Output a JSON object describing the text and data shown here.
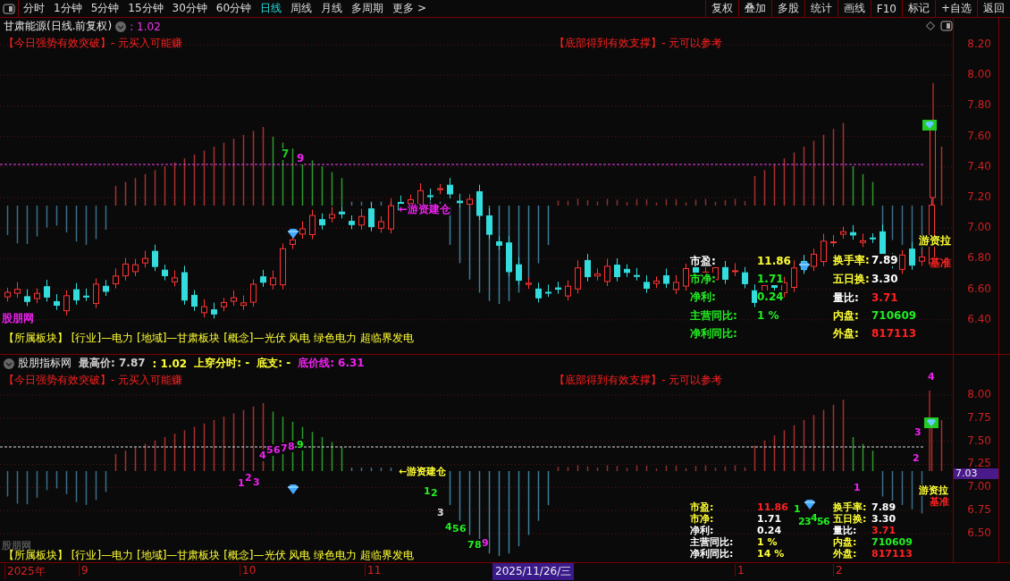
{
  "toolbar": {
    "periods": [
      {
        "label": "分时",
        "selected": false
      },
      {
        "label": "1分钟",
        "selected": false
      },
      {
        "label": "5分钟",
        "selected": false
      },
      {
        "label": "15分钟",
        "selected": false
      },
      {
        "label": "30分钟",
        "selected": false
      },
      {
        "label": "60分钟",
        "selected": false
      },
      {
        "label": "日线",
        "selected": true
      },
      {
        "label": "周线",
        "selected": false
      },
      {
        "label": "月线",
        "selected": false
      },
      {
        "label": "多周期",
        "selected": false
      },
      {
        "label": "更多 >",
        "selected": false
      }
    ],
    "buttons": [
      "复权",
      "叠加",
      "多股",
      "统计",
      "画线",
      "F10",
      "标记",
      "+自选",
      "返回"
    ]
  },
  "main_panel": {
    "title": "甘肃能源(日线.前复权)",
    "value": ": 1.02",
    "signals": [
      "【今日强势有效突破】- 元买入可能赚",
      "【底部得到有效支撑】- 元可以参考"
    ],
    "price_ticks": [
      "8.20",
      "8.00",
      "7.80",
      "7.60",
      "7.40",
      "7.20",
      "7.00",
      "6.80",
      "6.60",
      "6.40"
    ],
    "annotations": [
      {
        "text": "7",
        "color": "#22cc22"
      },
      {
        "text": "9",
        "color": "#ee22ee"
      },
      {
        "text": "←游资建仓",
        "color": "#ee22ee"
      },
      {
        "text": "游资拉",
        "color": "#ffff33"
      },
      {
        "text": "基准",
        "color": "#ff2222"
      },
      {
        "text": "股朋网",
        "color": "#ee22ee"
      }
    ],
    "stats": [
      {
        "label": {
          "text": "市盈:",
          "color": "#ffffff"
        },
        "value": {
          "text": "11.86",
          "color": "#ffff33"
        }
      },
      {
        "label": {
          "text": "市净:",
          "color": "#22ee22"
        },
        "value": {
          "text": "1.71",
          "color": "#22ee22"
        }
      },
      {
        "label": {
          "text": "净利:",
          "color": "#22ee22"
        },
        "value": {
          "text": "0.24",
          "color": "#22ee22"
        }
      },
      {
        "label": {
          "text": "主营同比:",
          "color": "#22ee22"
        },
        "value": {
          "text": "1 %",
          "color": "#22ee22"
        }
      },
      {
        "label": {
          "text": "净利同比:",
          "color": "#22ee22"
        }
      },
      {
        "label": {
          "text": "换手率:",
          "color": "#ffff33"
        },
        "value": {
          "text": "7.89",
          "color": "#ffffff"
        }
      },
      {
        "label": {
          "text": "五日换:",
          "color": "#ffff33"
        },
        "value": {
          "text": "3.30",
          "color": "#ffffff"
        }
      },
      {
        "label": {
          "text": "量比:",
          "color": "#ffffff"
        },
        "value": {
          "text": "3.71",
          "color": "#ff2222"
        }
      },
      {
        "label": {
          "text": "内盘:",
          "color": "#ffff33"
        },
        "value": {
          "text": "710609",
          "color": "#22ee22"
        }
      },
      {
        "label": {
          "text": "外盘:",
          "color": "#ffff33"
        },
        "value": {
          "text": "817113",
          "color": "#ff2222"
        }
      }
    ],
    "sectors": "【所属板块】 [行业]—电力 [地域]—甘肃板块 [概念]—光伏 风电 绿色电力 超临界发电"
  },
  "indicator_panel": {
    "name": "股朋指标网",
    "fields": [
      {
        "text": "最高价: 7.87",
        "color": "#cccccc"
      },
      {
        "text": ": 1.02",
        "color": "#ffff33"
      },
      {
        "text": "上穿分时: -",
        "color": "#ffff33"
      },
      {
        "text": "底支: -",
        "color": "#ffff33"
      },
      {
        "text": "底价线: 6.31",
        "color": "#ee22ee"
      }
    ],
    "signals": [
      "【今日强势有效突破】- 元买入可能赚",
      "【底部得到有效支撑】- 元可以参考"
    ],
    "price_ticks": [
      "8.00",
      "7.75",
      "7.50",
      "7.25",
      "7.00",
      "6.75",
      "6.50"
    ],
    "price_tag": "7.03",
    "annotations": [
      {
        "text": "1",
        "color": "#ee22ee"
      },
      {
        "text": "2",
        "color": "#ee22ee"
      },
      {
        "text": "3",
        "color": "#ee22ee"
      },
      {
        "text": "4",
        "color": "#ee22ee"
      },
      {
        "text": "5",
        "color": "#ee22ee"
      },
      {
        "text": "6",
        "color": "#ee22ee"
      },
      {
        "text": "7",
        "color": "#ee22ee"
      },
      {
        "text": "8",
        "color": "#ee22ee"
      },
      {
        "text": "9",
        "color": "#22ee22"
      },
      {
        "text": "←游资建仓",
        "color": "#ffff33"
      },
      {
        "text": "1",
        "color": "#22ee22"
      },
      {
        "text": "2",
        "color": "#22ee22"
      },
      {
        "text": "3",
        "color": "#dddddd"
      },
      {
        "text": "4",
        "color": "#22ee22"
      },
      {
        "text": "5",
        "color": "#22ee22"
      },
      {
        "text": "6",
        "color": "#22ee22"
      },
      {
        "text": "7",
        "color": "#22ee22"
      },
      {
        "text": "8",
        "color": "#22ee22"
      },
      {
        "text": "9",
        "color": "#ee22ee"
      },
      {
        "text": "1",
        "color": "#22ee22"
      },
      {
        "text": "2",
        "color": "#22ee22"
      },
      {
        "text": "3",
        "color": "#22ee22"
      },
      {
        "text": "4",
        "color": "#22ee22"
      },
      {
        "text": "5",
        "color": "#22ee22"
      },
      {
        "text": "6",
        "color": "#22ee22"
      },
      {
        "text": "1",
        "color": "#ee22ee"
      },
      {
        "text": "2",
        "color": "#ee22ee"
      },
      {
        "text": "3",
        "color": "#ee22ee"
      },
      {
        "text": "4",
        "color": "#ee22ee"
      },
      {
        "text": "游资拉",
        "color": "#ffff33"
      },
      {
        "text": "基准",
        "color": "#ff2222"
      },
      {
        "text": "股朋网",
        "color": "#555555"
      }
    ],
    "stats": [
      {
        "label": {
          "text": "市盈:",
          "color": "#ffff33"
        },
        "value": {
          "text": "11.86",
          "color": "#ff2222"
        }
      },
      {
        "label": {
          "text": "市净:",
          "color": "#ffff33"
        },
        "value": {
          "text": "1.71",
          "color": "#ffffff"
        }
      },
      {
        "label": {
          "text": "净利:",
          "color": "#ffffff"
        },
        "value": {
          "text": "0.24",
          "color": "#ffffff"
        }
      },
      {
        "label": {
          "text": "主营同比:",
          "color": "#ffffff"
        },
        "value": {
          "text": "1 %",
          "color": "#ffff33"
        }
      },
      {
        "label": {
          "text": "净利同比:",
          "color": "#ffffff"
        },
        "value": {
          "text": "14 %",
          "color": "#ffff33"
        }
      },
      {
        "label": {
          "text": "换手率:",
          "color": "#ffff33"
        },
        "value": {
          "text": "7.89",
          "color": "#ffffff"
        }
      },
      {
        "label": {
          "text": "五日换:",
          "color": "#ffff33"
        },
        "value": {
          "text": "3.30",
          "color": "#ffffff"
        }
      },
      {
        "label": {
          "text": "量比:",
          "color": "#ffffff"
        },
        "value": {
          "text": "3.71",
          "color": "#ff2222"
        }
      },
      {
        "label": {
          "text": "内盘:",
          "color": "#ffff33"
        },
        "value": {
          "text": "710609",
          "color": "#22ee22"
        }
      },
      {
        "label": {
          "text": "外盘:",
          "color": "#ffff33"
        },
        "value": {
          "text": "817113",
          "color": "#ff2222"
        }
      }
    ],
    "sectors": "【所属板块】 [行业]—电力 [地域]—甘肃板块 [概念]—光伏 风电 绿色电力 超临界发电"
  },
  "date_axis": {
    "labels": [
      "2025年",
      "9",
      "10",
      "11",
      "1",
      "2"
    ],
    "cursor_date": "2025/11/26/三"
  }
}
